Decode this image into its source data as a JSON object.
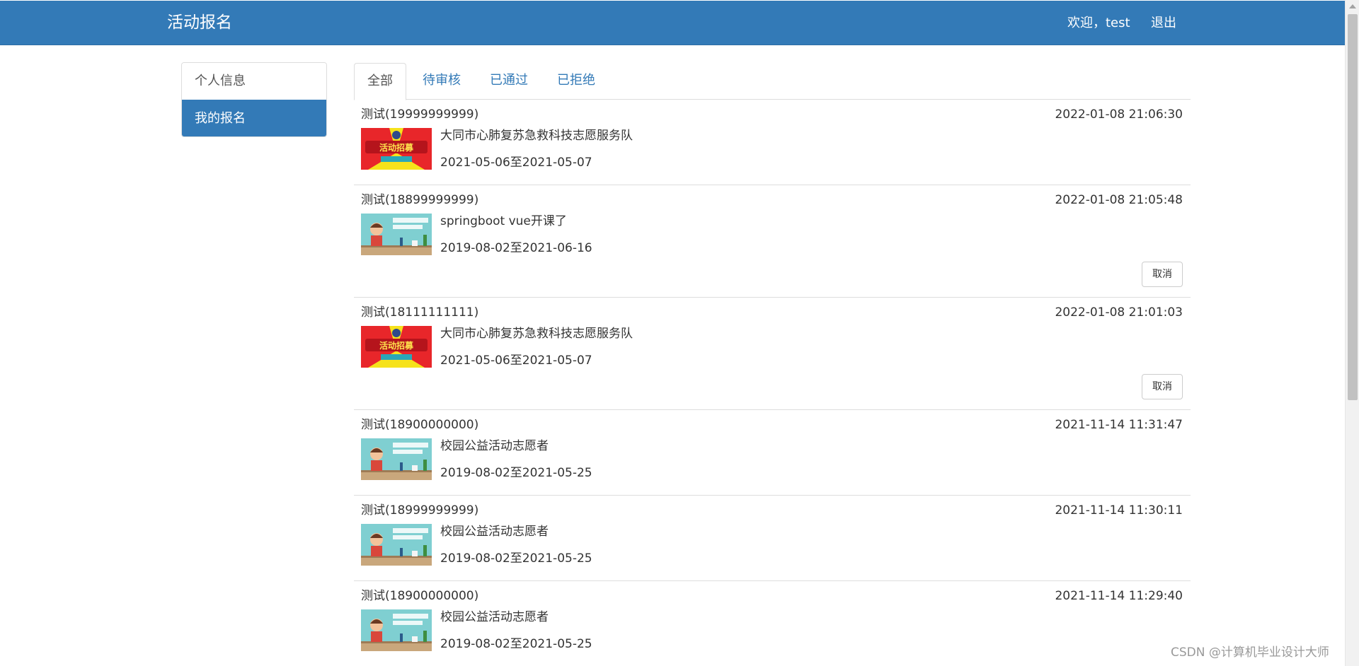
{
  "navbar": {
    "brand": "活动报名",
    "welcome": "欢迎，test",
    "logout": "退出"
  },
  "sidebar": {
    "items": [
      {
        "label": "个人信息",
        "active": false
      },
      {
        "label": "我的报名",
        "active": true
      }
    ]
  },
  "tabs": [
    {
      "label": "全部",
      "active": true
    },
    {
      "label": "待审核",
      "active": false
    },
    {
      "label": "已通过",
      "active": false
    },
    {
      "label": "已拒绝",
      "active": false
    }
  ],
  "records": [
    {
      "user": "测试(19999999999)",
      "time": "2022-01-08 21:06:30",
      "activity": "大同市心肺复苏急救科技志愿服务队",
      "dates": "2021-05-06至2021-05-07",
      "thumb": "banner",
      "cancel": null
    },
    {
      "user": "测试(18899999999)",
      "time": "2022-01-08 21:05:48",
      "activity": "springboot vue开课了",
      "dates": "2019-08-02至2021-06-16",
      "thumb": "classroom",
      "cancel": "取消"
    },
    {
      "user": "测试(18111111111)",
      "time": "2022-01-08 21:01:03",
      "activity": "大同市心肺复苏急救科技志愿服务队",
      "dates": "2021-05-06至2021-05-07",
      "thumb": "banner",
      "cancel": "取消"
    },
    {
      "user": "测试(18900000000)",
      "time": "2021-11-14 11:31:47",
      "activity": "校园公益活动志愿者",
      "dates": "2019-08-02至2021-05-25",
      "thumb": "classroom",
      "cancel": null
    },
    {
      "user": "测试(18999999999)",
      "time": "2021-11-14 11:30:11",
      "activity": "校园公益活动志愿者",
      "dates": "2019-08-02至2021-05-25",
      "thumb": "classroom",
      "cancel": null
    },
    {
      "user": "测试(18900000000)",
      "time": "2021-11-14 11:29:40",
      "activity": "校园公益活动志愿者",
      "dates": "2019-08-02至2021-05-25",
      "thumb": "classroom",
      "cancel": null
    }
  ],
  "watermark": "CSDN @计算机毕业设计大师"
}
